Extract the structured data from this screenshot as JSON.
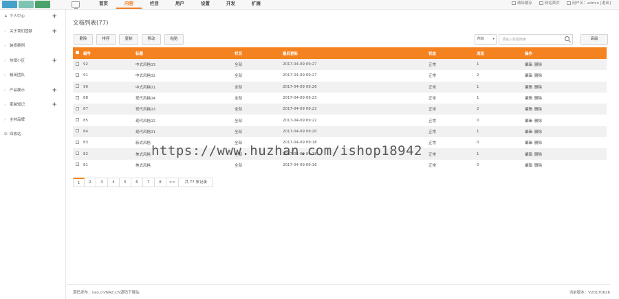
{
  "topnav": {
    "items": [
      "首页",
      "内容",
      "栏目",
      "用户",
      "设置",
      "开发",
      "扩展"
    ],
    "active_index": 1,
    "right": {
      "cache": "清除缓存",
      "site": "网站首页",
      "user": "用户名：admin [退出]"
    }
  },
  "sidebar": {
    "items": [
      {
        "prefix": "♟",
        "label": "个人中心",
        "expandable": true
      },
      {
        "prefix": "›",
        "label": "关于我们团献",
        "expandable": true
      },
      {
        "prefix": "›",
        "label": "装修案例",
        "expandable": false
      },
      {
        "prefix": "›",
        "label": "热销小区",
        "expandable": true
      },
      {
        "prefix": "›",
        "label": "精英团队",
        "expandable": false
      },
      {
        "prefix": "›",
        "label": "产品展示",
        "expandable": true
      },
      {
        "prefix": "›",
        "label": "家装知识",
        "expandable": true
      },
      {
        "prefix": "›",
        "label": "主材品牌",
        "expandable": false
      },
      {
        "prefix": "✪",
        "label": "回收站",
        "expandable": false
      }
    ]
  },
  "main": {
    "title": "文档列表(77)",
    "toolbar": [
      "删除",
      "排序",
      "复制",
      "移动",
      "粘贴"
    ],
    "search": {
      "select": "所有",
      "placeholder": "请输入标题搜索",
      "button": "高级"
    }
  },
  "table": {
    "headers": {
      "id": "编号",
      "title": "标题",
      "category": "栏目",
      "time": "最后更新",
      "status": "状态",
      "views": "浏览",
      "ops": "操作"
    },
    "rows": [
      {
        "id": "92",
        "title": "中式风格03",
        "category": "全部",
        "time": "2017-04-09 09:27",
        "status": "正常",
        "views": "1"
      },
      {
        "id": "91",
        "title": "中式风格02",
        "category": "全部",
        "time": "2017-04-09 09:27",
        "status": "正常",
        "views": "2"
      },
      {
        "id": "90",
        "title": "中式风格01",
        "category": "全部",
        "time": "2017-04-09 09:26",
        "status": "正常",
        "views": "1"
      },
      {
        "id": "88",
        "title": "现代风格04",
        "category": "全部",
        "time": "2017-04-09 09:23",
        "status": "正常",
        "views": "1"
      },
      {
        "id": "87",
        "title": "现代风格03",
        "category": "全部",
        "time": "2017-04-09 09:22",
        "status": "正常",
        "views": "2"
      },
      {
        "id": "85",
        "title": "现代风格02",
        "category": "全部",
        "time": "2017-04-09 09:22",
        "status": "正常",
        "views": "0"
      },
      {
        "id": "84",
        "title": "现代风格01",
        "category": "全部",
        "time": "2017-04-09 09:20",
        "status": "正常",
        "views": "1"
      },
      {
        "id": "83",
        "title": "新式风格",
        "category": "全部",
        "time": "2017-04-09 09:18",
        "status": "正常",
        "views": "0"
      },
      {
        "id": "82",
        "title": "美式风格",
        "category": "全部",
        "time": "2017-04-09 09:18",
        "status": "正常",
        "views": "1"
      },
      {
        "id": "81",
        "title": "美式风格",
        "category": "全部",
        "time": "2017-04-09 09:16",
        "status": "正常",
        "views": "0"
      }
    ],
    "op_edit": "编辑",
    "op_delete": "删除"
  },
  "pager": {
    "pages": [
      "1",
      "2",
      "3",
      "4",
      "5",
      "6",
      "7",
      "8",
      ">>"
    ],
    "total": "共 77 条记录"
  },
  "footer": {
    "left": "源码发布：nao.cn/NAZ.CN源码下载站",
    "right": "当前版本：V20170626"
  },
  "watermark": "https://www.huzhan.com/ishop18942"
}
